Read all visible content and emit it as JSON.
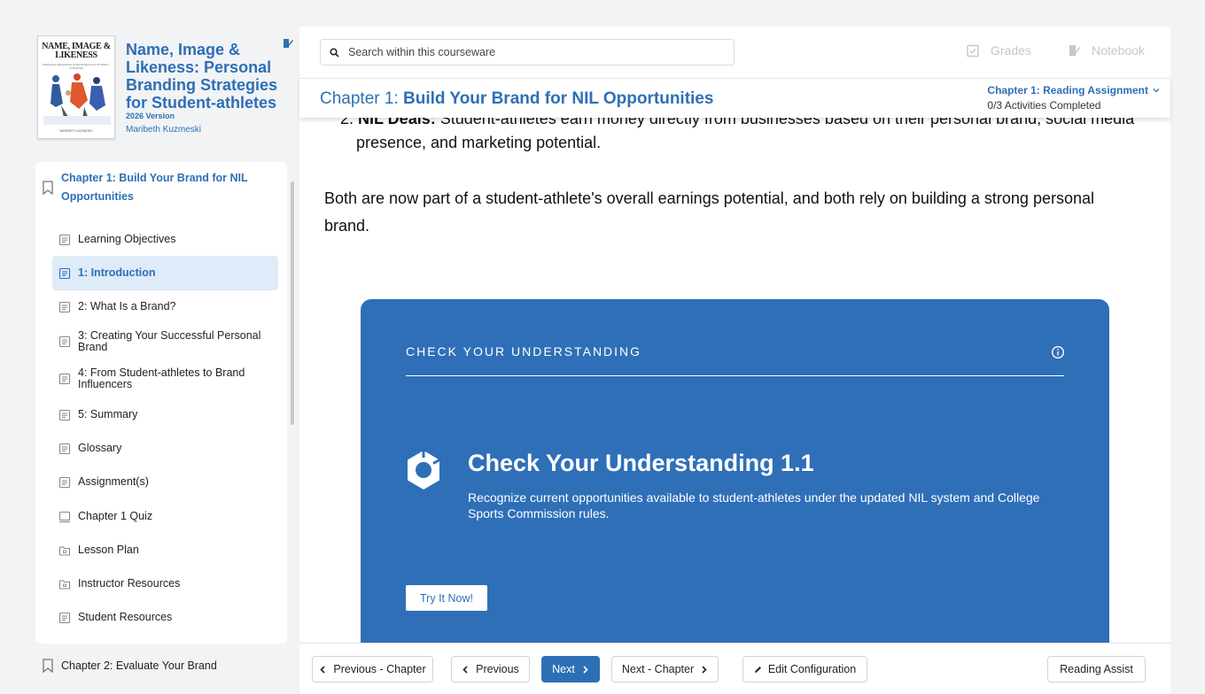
{
  "book": {
    "cover_title": "NAME, IMAGE & LIKENESS",
    "cover_subtitle": "PERSONAL BRANDING STRATEGIES FOR STUDENT-ATHLETES",
    "cover_author": "MARIBETH KUZMESKI",
    "title": "Name, Image & Likeness: Personal Branding Strategies for Student-athletes",
    "version": "2026 Version",
    "author": "Maribeth Kuzmeski"
  },
  "toc": {
    "chapter_label": "Chapter 1: Build Your Brand for NIL Opportunities",
    "items": [
      {
        "label": "Learning Objectives",
        "icon": "document-icon"
      },
      {
        "label": "1: Introduction",
        "icon": "document-icon",
        "active": true
      },
      {
        "label": "2: What Is a Brand?",
        "icon": "document-icon"
      },
      {
        "label": "3: Creating Your Successful Personal Brand",
        "icon": "document-icon"
      },
      {
        "label": "4: From Student-athletes to Brand Influencers",
        "icon": "document-icon"
      },
      {
        "label": "5: Summary",
        "icon": "document-icon"
      },
      {
        "label": "Glossary",
        "icon": "document-icon"
      },
      {
        "label": "Assignment(s)",
        "icon": "document-icon"
      },
      {
        "label": "Chapter 1 Quiz",
        "icon": "laptop-icon"
      },
      {
        "label": "Lesson Plan",
        "icon": "folder-icon"
      },
      {
        "label": "Instructor Resources",
        "icon": "folder-icon"
      },
      {
        "label": "Student Resources",
        "icon": "document-icon"
      }
    ],
    "next_chapter": "Chapter 2: Evaluate Your Brand"
  },
  "search": {
    "placeholder": "Search within this courseware"
  },
  "top_links": {
    "grades": "Grades",
    "notebook": "Notebook"
  },
  "chapter_bar": {
    "prefix": "Chapter 1: ",
    "title": "Build Your Brand for NIL Opportunities",
    "assignment_title": "Chapter 1: Reading Assignment",
    "assignment_progress": "0/3 Activities Completed"
  },
  "content": {
    "cut_prefix": "2. ",
    "cut_bold": "NIL Deals:",
    "cut_rest": " Student-athletes earn money directly from businesses based on their personal brand, social media",
    "cut_cont": "presence, and marketing potential.",
    "paragraph": "Both are now part of a student-athlete's overall earnings potential, and both rely on building a strong personal brand."
  },
  "cyu": {
    "header": "CHECK YOUR UNDERSTANDING",
    "title": "Check Your Understanding 1.1",
    "description": "Recognize current opportunities available to student-athletes under the updated NIL system and College Sports Commission rules.",
    "button": "Try It Now!"
  },
  "bottom_nav": {
    "prev_chapter": "Previous - Chapter",
    "previous": "Previous",
    "next": "Next",
    "next_chapter": "Next - Chapter",
    "edit_config": "Edit Configuration",
    "reading_assist": "Reading Assist"
  },
  "colors": {
    "accent": "#2d6fb5",
    "card": "#2f6fb8",
    "active_bg": "#deebf8"
  }
}
